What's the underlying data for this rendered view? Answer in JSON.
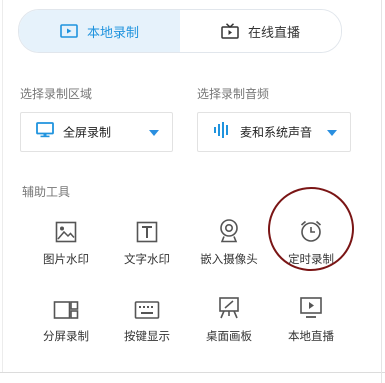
{
  "tabs": [
    {
      "label": "本地录制",
      "active": true,
      "icon": "record-icon"
    },
    {
      "label": "在线直播",
      "active": false,
      "icon": "tv-icon"
    }
  ],
  "area_section": {
    "label": "选择录制区域",
    "selected": "全屏录制",
    "icon": "monitor-icon"
  },
  "audio_section": {
    "label": "选择录制音频",
    "selected": "麦和系统声音",
    "icon": "audio-wave-icon"
  },
  "tools_section": {
    "label": "辅助工具",
    "items": [
      {
        "label": "图片水印",
        "icon": "image-icon"
      },
      {
        "label": "文字水印",
        "icon": "text-icon"
      },
      {
        "label": "嵌入摄像头",
        "icon": "webcam-icon"
      },
      {
        "label": "定时录制",
        "icon": "alarm-clock-icon"
      },
      {
        "label": "分屏录制",
        "icon": "split-screen-icon"
      },
      {
        "label": "按键显示",
        "icon": "keyboard-icon"
      },
      {
        "label": "桌面画板",
        "icon": "easel-icon"
      },
      {
        "label": "本地直播",
        "icon": "play-monitor-icon"
      }
    ]
  },
  "colors": {
    "accent": "#1f93de",
    "active_tab_bg": "#e6f2fb",
    "highlight": "#7a1515"
  }
}
